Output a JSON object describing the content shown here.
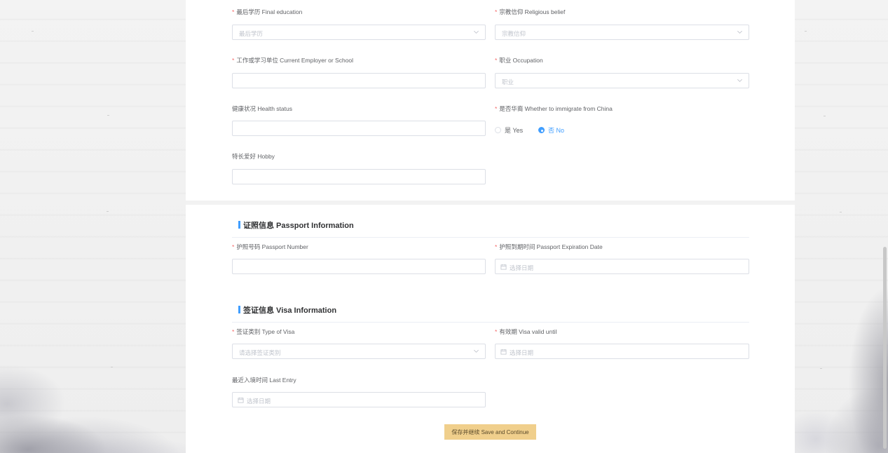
{
  "personal": {
    "final_education": {
      "label": "最后学历 Final education",
      "required": true,
      "placeholder": "最后学历"
    },
    "religious_belief": {
      "label": "宗教信仰 Religious belief",
      "required": true,
      "placeholder": "宗教信仰"
    },
    "employer": {
      "label": "工作或学习单位 Current Employer or School",
      "required": true,
      "value": ""
    },
    "occupation": {
      "label": "职业 Occupation",
      "required": true,
      "placeholder": "职业"
    },
    "health": {
      "label": "健康状况 Health status",
      "required": false,
      "value": ""
    },
    "immigrate": {
      "label": "是否华裔 Whether to immigrate from China",
      "required": true,
      "options": [
        {
          "label": "是 Yes",
          "selected": false
        },
        {
          "label": "否 No",
          "selected": true
        }
      ]
    },
    "hobby": {
      "label": "特长爱好 Hobby",
      "required": false,
      "value": ""
    }
  },
  "passport": {
    "title": "证照信息 Passport Information",
    "number": {
      "label": "护照号码 Passport Number",
      "required": true,
      "value": ""
    },
    "expiration": {
      "label": "护照到期时间 Passport Expiration Date",
      "required": true,
      "placeholder": "选择日期"
    }
  },
  "visa": {
    "title": "签证信息 Visa Information",
    "type": {
      "label": "签证类别 Type of Visa",
      "required": true,
      "placeholder": "请选择签证类别"
    },
    "valid_until": {
      "label": "有效期 Visa valid until",
      "required": true,
      "placeholder": "选择日期"
    },
    "last_entry": {
      "label": "最近入境时间 Last Entry",
      "required": false,
      "placeholder": "选择日期"
    }
  },
  "actions": {
    "save_label": "保存并继续 Save and Continue"
  },
  "colors": {
    "accent": "#409eff",
    "required": "#f56c6c",
    "save_button": "#f0cf8c",
    "border": "#dcdfe6"
  },
  "icons": {
    "select": "chevron-down-icon",
    "date": "calendar-icon"
  }
}
